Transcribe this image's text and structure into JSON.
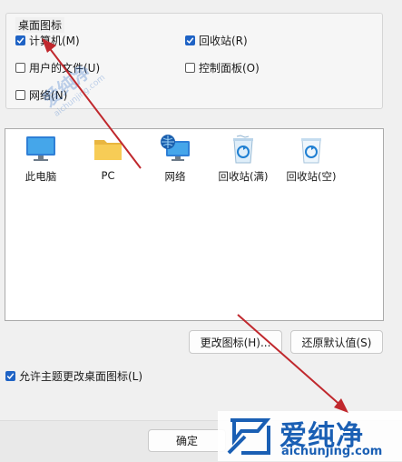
{
  "desktop_icons_group": {
    "title": "桌面图标",
    "checkboxes": [
      {
        "label": "计算机(M)",
        "checked": true
      },
      {
        "label": "回收站(R)",
        "checked": true
      },
      {
        "label": "用户的文件(U)",
        "checked": false
      },
      {
        "label": "控制面板(O)",
        "checked": false
      },
      {
        "label": "网络(N)",
        "checked": false
      }
    ]
  },
  "preview_icons": [
    {
      "label": "此电脑",
      "icon": "monitor-icon"
    },
    {
      "label": "PC",
      "icon": "folder-icon"
    },
    {
      "label": "网络",
      "icon": "network-globe-icon"
    },
    {
      "label": "回收站(满)",
      "icon": "recycle-bin-full-icon"
    },
    {
      "label": "回收站(空)",
      "icon": "recycle-bin-empty-icon"
    }
  ],
  "buttons": {
    "change_icon": "更改图标(H)...",
    "restore_default": "还原默认值(S)",
    "ok": "确定"
  },
  "allow_themes": {
    "label": "允许主题更改桌面图标(L)",
    "checked": true
  },
  "watermark": {
    "brand": "爱纯净",
    "url": "aichunjing.com"
  },
  "colors": {
    "accent": "#1f63c5",
    "annotation_arrow": "#c0282d"
  }
}
